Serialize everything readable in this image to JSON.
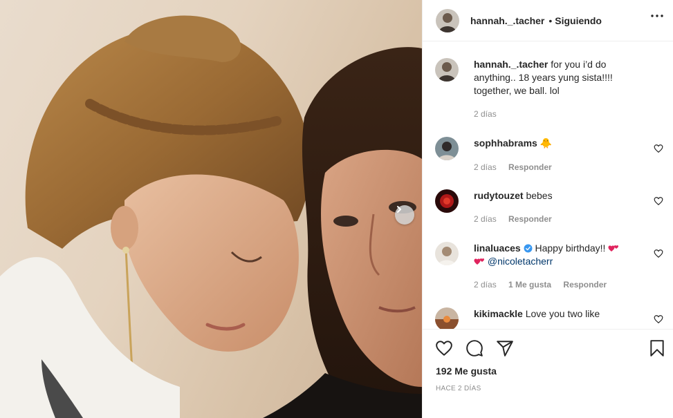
{
  "post": {
    "username": "hannah._.tacher",
    "separator": "•",
    "follow_status": "Siguiendo",
    "caption": "for you i’d do anything.. 18 years yung sista!!!! together, we ball. lol",
    "caption_time": "2 días"
  },
  "comments": [
    {
      "username": "sophhabrams",
      "text": "",
      "emoji": "🐥",
      "time": "2 días",
      "reply": "Responder"
    },
    {
      "username": "rudytouzet",
      "text": "bebes",
      "time": "2 días",
      "reply": "Responder"
    },
    {
      "username": "linaluaces",
      "verified": true,
      "text": "Happy birthday!!",
      "mention": "@nicoletacherr",
      "time": "2 días",
      "likes": "1 Me gusta",
      "reply": "Responder"
    },
    {
      "username": "kikimackle",
      "text": "Love you two like"
    }
  ],
  "actions": {
    "likes": "192 Me gusta",
    "date": "HACE 2 DÍAS"
  },
  "icons": {
    "more": "more-icon",
    "next": "chevron-right-icon",
    "like": "heart-icon",
    "comment": "comment-icon",
    "share": "paper-plane-icon",
    "save": "bookmark-icon",
    "verified": "verified-badge-icon"
  },
  "colors": {
    "verified": "#3897f0",
    "heart_emoji": "#e0245e",
    "muted": "#8e8e8e",
    "mention": "#00376b"
  }
}
